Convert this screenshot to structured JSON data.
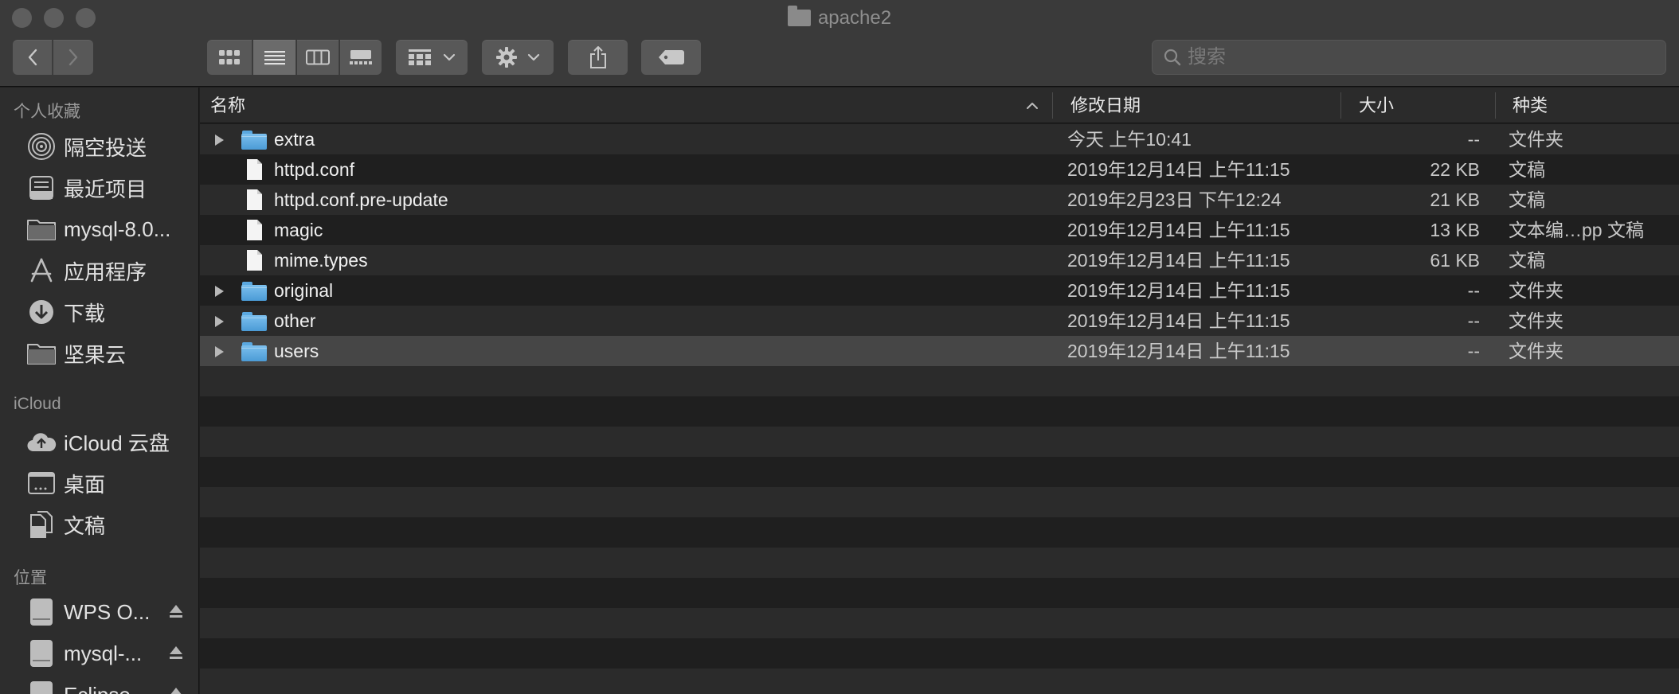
{
  "window": {
    "title": "apache2",
    "traffic_lights": [
      "close",
      "minimize",
      "zoom"
    ]
  },
  "toolbar": {
    "back_icon": "chevron-left-icon",
    "forward_icon": "chevron-right-icon",
    "view_modes": [
      "icon-view-icon",
      "list-view-icon",
      "column-view-icon",
      "gallery-view-icon"
    ],
    "active_view": "list-view-icon",
    "group_icon": "group-by-icon",
    "action_icon": "gear-icon",
    "share_icon": "share-icon",
    "tag_icon": "tag-icon",
    "search_placeholder": "搜索"
  },
  "sidebar": {
    "sections": [
      {
        "title": "个人收藏",
        "items": [
          {
            "label": "隔空投送",
            "icon": "airdrop-icon"
          },
          {
            "label": "最近项目",
            "icon": "recents-icon"
          },
          {
            "label": "mysql-8.0...",
            "icon": "folder-icon"
          },
          {
            "label": "应用程序",
            "icon": "applications-icon"
          },
          {
            "label": "下载",
            "icon": "downloads-icon"
          },
          {
            "label": "坚果云",
            "icon": "folder-icon"
          }
        ]
      },
      {
        "title": "iCloud",
        "items": [
          {
            "label": "iCloud 云盘",
            "icon": "icloud-icon"
          },
          {
            "label": "桌面",
            "icon": "desktop-icon"
          },
          {
            "label": "文稿",
            "icon": "documents-icon"
          }
        ]
      },
      {
        "title": "位置",
        "items": [
          {
            "label": "WPS O...",
            "icon": "disk-icon",
            "eject": true
          },
          {
            "label": "mysql-...",
            "icon": "disk-icon",
            "eject": true
          },
          {
            "label": "Eclipse...",
            "icon": "disk-icon",
            "eject": true
          }
        ]
      }
    ]
  },
  "columns": {
    "name": "名称",
    "date": "修改日期",
    "size": "大小",
    "kind": "种类",
    "sort_indicator": "chevron-up-icon"
  },
  "files": [
    {
      "name": "extra",
      "type": "folder",
      "date": "今天 上午10:41",
      "size": "--",
      "kind": "文件夹"
    },
    {
      "name": "httpd.conf",
      "type": "file",
      "date": "2019年12月14日 上午11:15",
      "size": "22 KB",
      "kind": "文稿"
    },
    {
      "name": "httpd.conf.pre-update",
      "type": "file",
      "date": "2019年2月23日 下午12:24",
      "size": "21 KB",
      "kind": "文稿"
    },
    {
      "name": "magic",
      "type": "file",
      "date": "2019年12月14日 上午11:15",
      "size": "13 KB",
      "kind": "文本编…pp 文稿"
    },
    {
      "name": "mime.types",
      "type": "file",
      "date": "2019年12月14日 上午11:15",
      "size": "61 KB",
      "kind": "文稿"
    },
    {
      "name": "original",
      "type": "folder",
      "date": "2019年12月14日 上午11:15",
      "size": "--",
      "kind": "文件夹"
    },
    {
      "name": "other",
      "type": "folder",
      "date": "2019年12月14日 上午11:15",
      "size": "--",
      "kind": "文件夹"
    },
    {
      "name": "users",
      "type": "folder",
      "date": "2019年12月14日 上午11:15",
      "size": "--",
      "kind": "文件夹",
      "selected": true
    }
  ],
  "colors": {
    "folder_blue": "#5aa8e0",
    "selection": "#464646",
    "row_alt": "#2b2b2b",
    "row_base": "#1f1f1f"
  }
}
